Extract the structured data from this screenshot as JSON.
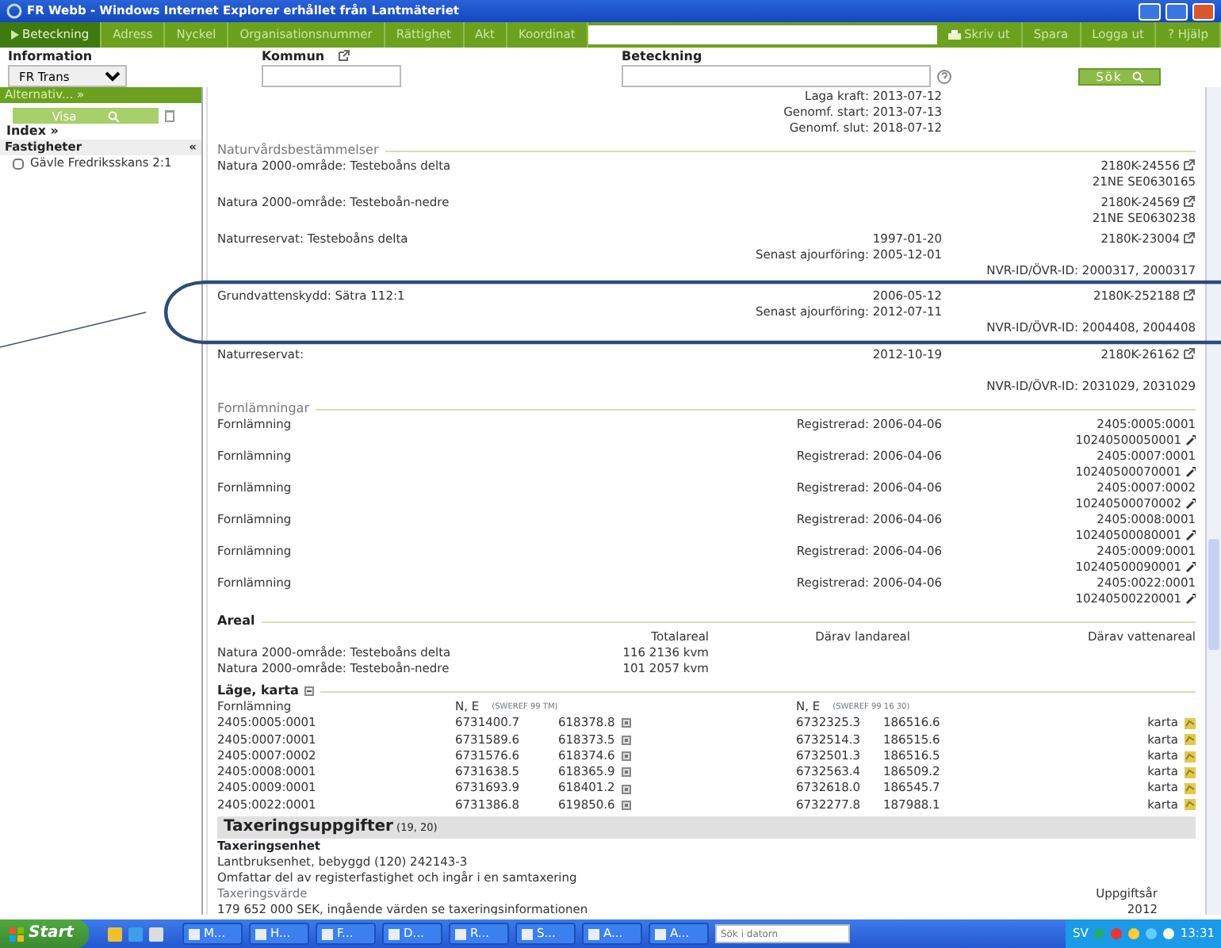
{
  "window": {
    "title": "FR Webb - Windows Internet Explorer erhållet från Lantmäteriet"
  },
  "nav": {
    "tabs": [
      {
        "label": "Beteckning",
        "selected": true
      },
      {
        "label": "Adress",
        "selected": false
      },
      {
        "label": "Nyckel",
        "selected": false
      },
      {
        "label": "Organisationsnummer",
        "selected": false
      },
      {
        "label": "Rättighet",
        "selected": false
      },
      {
        "label": "Akt",
        "selected": false
      },
      {
        "label": "Koordinat",
        "selected": false
      }
    ],
    "actions": [
      "Skriv ut",
      "Spara",
      "Logga ut",
      "? Hjälp"
    ]
  },
  "search": {
    "labels": [
      "Information",
      "Kommun",
      "Beteckning"
    ],
    "information_value": "FR Trans",
    "button": "Sök"
  },
  "sidebar": {
    "alternativ": "Alternativ... »",
    "visa": "Visa",
    "index": "Index »",
    "fastigheter": "Fastigheter",
    "collapse": "«",
    "items": [
      {
        "label": "Gävle Fredriksskans 2:1",
        "checked": false
      }
    ]
  },
  "plan_dates": [
    {
      "label": "Laga kraft:",
      "value": "2013-07-12"
    },
    {
      "label": "Genomf. start:",
      "value": "2013-07-13"
    },
    {
      "label": "Genomf. slut:",
      "value": "2018-07-12"
    }
  ],
  "naturvard": {
    "title": "Naturvårdsbestämmelser",
    "rows": [
      {
        "name": "Natura 2000-område: Testeboåns delta",
        "circled": false,
        "dates": [],
        "refs": [
          {
            "text": "2180K-24556",
            "link": true
          },
          {
            "text": "21NE  SE0630165",
            "link": false
          }
        ]
      },
      {
        "name": "Natura 2000-område: Testeboån-nedre",
        "circled": false,
        "dates": [],
        "refs": [
          {
            "text": "2180K-24569",
            "link": true
          },
          {
            "text": "21NE  SE0630238",
            "link": false
          }
        ]
      },
      {
        "name": "Naturreservat: Testeboåns delta",
        "circled": false,
        "dates": [
          "1997-01-20",
          "Senast ajourföring: 2005-12-01"
        ],
        "refs": [
          {
            "text": "2180K-23004",
            "link": true
          },
          {
            "text": "NVR-ID/ÖVR-ID: 2000317, 2000317",
            "link": false
          }
        ]
      },
      {
        "name": "Grundvattenskydd: Sätra 112:1",
        "circled": true,
        "dates": [
          "2006-05-12",
          "Senast ajourföring: 2012-07-11"
        ],
        "refs": [
          {
            "text": "2180K-252188",
            "link": true
          },
          {
            "text": "NVR-ID/ÖVR-ID: 2004408, 2004408",
            "link": false
          }
        ]
      },
      {
        "name": "Naturreservat:",
        "circled": false,
        "dates": [
          "2012-10-19"
        ],
        "refs": [
          {
            "text": "2180K-26162",
            "link": true
          },
          {
            "text": "NVR-ID/ÖVR-ID: 2031029, 2031029",
            "link": false
          }
        ]
      }
    ]
  },
  "fornlamningar": {
    "title": "Fornlämningar",
    "rows": [
      {
        "name": "Fornlämning",
        "registered": "Registrerad: 2006-04-06",
        "id": "2405:0005:0001",
        "ref": "10240500050001"
      },
      {
        "name": "Fornlämning",
        "registered": "Registrerad: 2006-04-06",
        "id": "2405:0007:0001",
        "ref": "10240500070001"
      },
      {
        "name": "Fornlämning",
        "registered": "Registrerad: 2006-04-06",
        "id": "2405:0007:0002",
        "ref": "10240500070002"
      },
      {
        "name": "Fornlämning",
        "registered": "Registrerad: 2006-04-06",
        "id": "2405:0008:0001",
        "ref": "10240500080001"
      },
      {
        "name": "Fornlämning",
        "registered": "Registrerad: 2006-04-06",
        "id": "2405:0009:0001",
        "ref": "10240500090001"
      },
      {
        "name": "Fornlämning",
        "registered": "Registrerad: 2006-04-06",
        "id": "2405:0022:0001",
        "ref": "10240500220001"
      }
    ]
  },
  "areal": {
    "title": "Areal",
    "columns": [
      "Totalareal",
      "Därav landareal",
      "Därav vattenareal"
    ],
    "rows": [
      {
        "name": "Natura 2000-område: Testeboåns delta",
        "total": "116 2136 kvm"
      },
      {
        "name": "Natura 2000-område: Testeboån-nedre",
        "total": "101 2057 kvm"
      }
    ]
  },
  "lage": {
    "title": "Läge, karta",
    "columns": [
      "Fornlämning",
      "N, E",
      "(SWEREF 99 TM)",
      "N, E",
      "(SWEREF 99 16 30)"
    ],
    "rows": [
      {
        "id": "2405:0005:0001",
        "n1": "6731400.7",
        "e1": "618378.8",
        "n2": "6732325.3",
        "e2": "186516.6",
        "map": "karta"
      },
      {
        "id": "2405:0007:0001",
        "n1": "6731589.6",
        "e1": "618373.5",
        "n2": "6732514.3",
        "e2": "186515.6",
        "map": "karta"
      },
      {
        "id": "2405:0007:0002",
        "n1": "6731576.6",
        "e1": "618374.6",
        "n2": "6732501.3",
        "e2": "186516.5",
        "map": "karta"
      },
      {
        "id": "2405:0008:0001",
        "n1": "6731638.5",
        "e1": "618365.9",
        "n2": "6732563.4",
        "e2": "186509.2",
        "map": "karta"
      },
      {
        "id": "2405:0009:0001",
        "n1": "6731693.9",
        "e1": "618401.2",
        "n2": "6732618.0",
        "e2": "186545.7",
        "map": "karta"
      },
      {
        "id": "2405:0022:0001",
        "n1": "6731386.8",
        "e1": "619850.6",
        "n2": "6732277.8",
        "e2": "187988.1",
        "map": "karta"
      }
    ]
  },
  "taxering": {
    "title": "Taxeringsuppgifter",
    "note": "(19, 20)",
    "unit_title": "Taxeringsenhet",
    "lines": [
      "Lantbruksenhet, bebyggd (120)  242143-3",
      "Omfattar del av registerfastighet och ingår i en samtaxering"
    ],
    "value_label": "Taxeringsvärde",
    "value": "179 652 000 SEK, ingående värden se taxeringsinformationen",
    "year_label": "Uppgiftsår",
    "year": "2012"
  },
  "taskbar": {
    "start": "Start",
    "tasks": [
      "M...",
      "H...",
      "F...",
      "D...",
      "R...",
      "S...",
      "A...",
      "A..."
    ],
    "search_placeholder": "Sök i datorn",
    "language": "SV",
    "clock": "13:31"
  }
}
